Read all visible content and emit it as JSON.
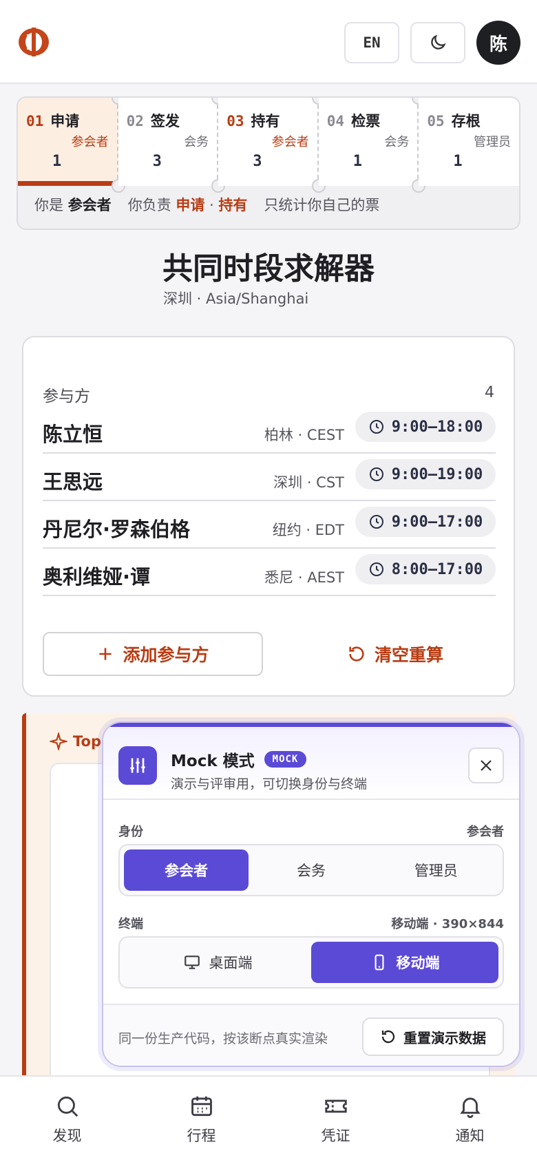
{
  "header": {
    "lang_label": "EN",
    "avatar_initial": "陈",
    "icons": [
      "brand-logo",
      "moon-icon"
    ]
  },
  "stages": [
    {
      "num": "01",
      "name": "申请",
      "role": "参会者",
      "count": "1",
      "active": true,
      "highlight": true
    },
    {
      "num": "02",
      "name": "签发",
      "role": "会务",
      "count": "3",
      "active": false,
      "highlight": false
    },
    {
      "num": "03",
      "name": "持有",
      "role": "参会者",
      "count": "3",
      "active": false,
      "highlight": true
    },
    {
      "num": "04",
      "name": "检票",
      "role": "会务",
      "count": "1",
      "active": false,
      "highlight": false
    },
    {
      "num": "05",
      "name": "存根",
      "role": "管理员",
      "count": "1",
      "active": false,
      "highlight": false
    }
  ],
  "stage_footer": {
    "you_are": "你是",
    "role": "参会者",
    "responsible": "你负责",
    "resp_1": "申请",
    "sep": "·",
    "resp_2": "持有",
    "note": "只统计你自己的票"
  },
  "page": {
    "title": "共同时段求解器",
    "subtitle": "深圳 · Asia/Shanghai"
  },
  "participants": {
    "label": "参与方",
    "count": "4",
    "rows": [
      {
        "name": "陈立恒",
        "zone": "柏林 · CEST",
        "hours": "9:00–18:00"
      },
      {
        "name": "王思远",
        "zone": "深圳 · CST",
        "hours": "9:00–19:00"
      },
      {
        "name": "丹尼尔·罗森伯格",
        "zone": "纽约 · EDT",
        "hours": "9:00–17:00"
      },
      {
        "name": "奥利维娅·谭",
        "zone": "悉尼 · AEST",
        "hours": "8:00–17:00"
      }
    ],
    "add_label": "添加参与方",
    "clear_label": "清空重算"
  },
  "top_section": {
    "label": "Top"
  },
  "mock": {
    "title": "Mock 模式",
    "badge": "MOCK",
    "subtitle": "演示与评审用，可切换身份与终端",
    "identity_label": "身份",
    "identity_value": "参会者",
    "identity_options": [
      "参会者",
      "会务",
      "管理员"
    ],
    "identity_selected": 0,
    "terminal_label": "终端",
    "terminal_value": "移动端 · 390×844",
    "terminal_options": [
      "桌面端",
      "移动端"
    ],
    "terminal_selected": 1,
    "footer_text": "同一份生产代码，按该断点真实渲染",
    "reset_label": "重置演示数据"
  },
  "bottom_nav": [
    {
      "label": "发现",
      "icon": "search-icon"
    },
    {
      "label": "行程",
      "icon": "calendar-icon"
    },
    {
      "label": "凭证",
      "icon": "ticket-icon"
    },
    {
      "label": "通知",
      "icon": "bell-icon"
    }
  ],
  "colors": {
    "accent": "#b83d14",
    "mock_accent": "#5b4ad6",
    "dark": "#1d1f22"
  }
}
